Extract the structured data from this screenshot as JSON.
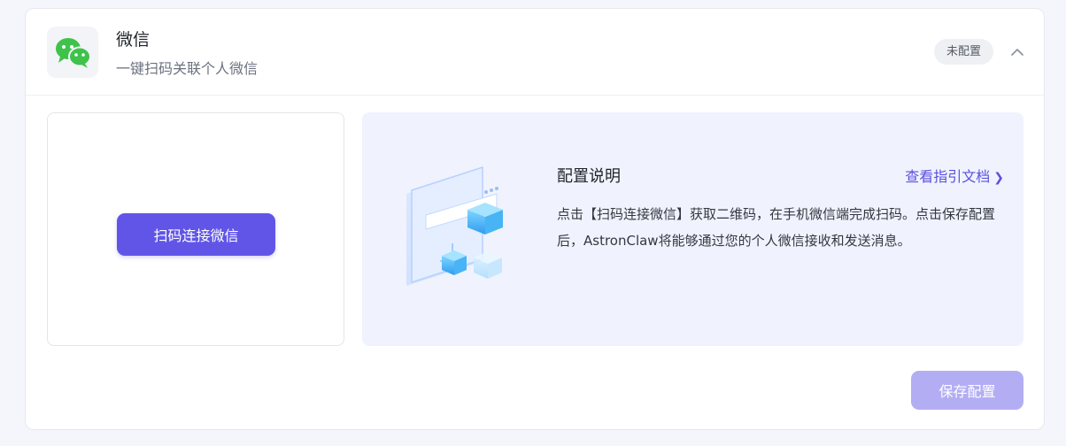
{
  "header": {
    "app_icon": "wechat-icon",
    "title": "微信",
    "subtitle": "一键扫码关联个人微信",
    "status_badge": "未配置",
    "collapse_icon": "chevron-up-icon"
  },
  "qr_panel": {
    "connect_button_label": "扫码连接微信"
  },
  "info_panel": {
    "illustration": "config-illustration",
    "title": "配置说明",
    "guide_link_label": "查看指引文档",
    "guide_link_icon": "chevron-right-icon",
    "description": "点击【扫码连接微信】获取二维码，在手机微信端完成扫码。点击保存配置后，AstronClaw将能够通过您的个人微信接收和发送消息。"
  },
  "footer": {
    "save_button_label": "保存配置"
  },
  "colors": {
    "accent": "#6155e8",
    "accent_disabled": "#b3aef3",
    "link": "#5b50e0",
    "wechat_green": "#3fc24a",
    "info_bg": "#f0f3fd"
  }
}
